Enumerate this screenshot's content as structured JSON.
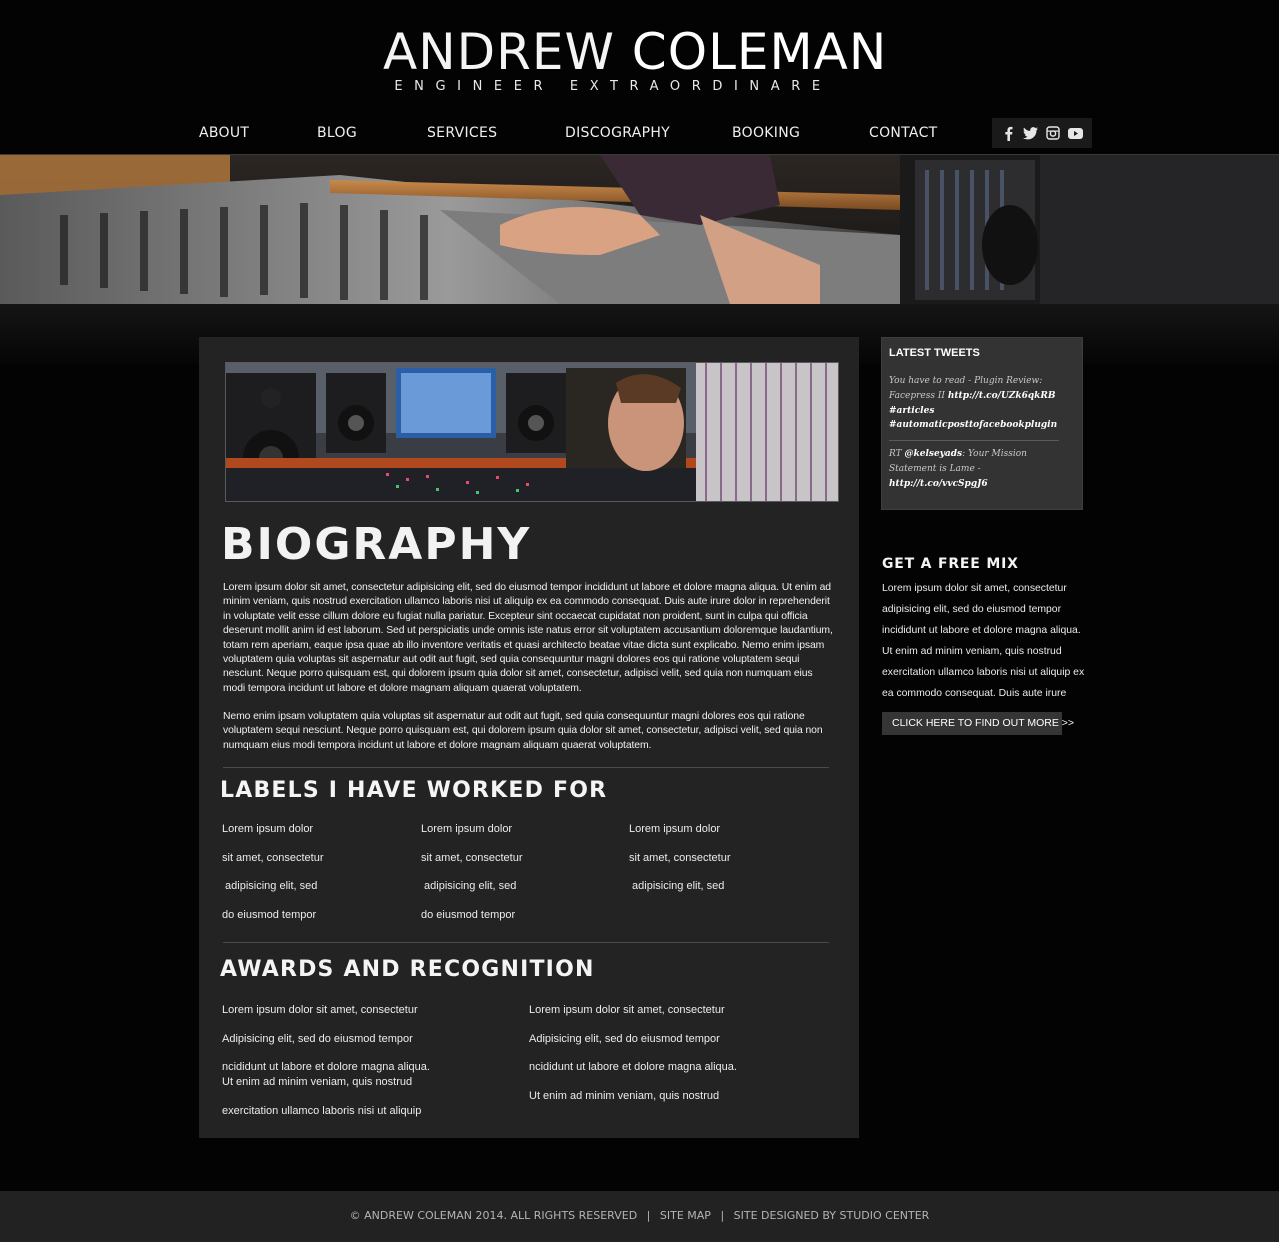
{
  "header": {
    "name_first": "ANDREW",
    "name_last": "COLEMAN",
    "tagline": "ENGINEER EXTRAORDINARE"
  },
  "nav": {
    "items": [
      "ABOUT",
      "BLOG",
      "SERVICES",
      "DISCOGRAPHY",
      "BOOKING",
      "CONTACT"
    ],
    "social_icons": [
      "facebook-icon",
      "twitter-icon",
      "instagram-icon",
      "youtube-icon"
    ]
  },
  "main": {
    "bio_title": "BIOGRAPHY",
    "bio_para1": "Lorem ipsum dolor sit amet, consectetur adipisicing elit, sed do eiusmod tempor incididunt ut labore et dolore magna aliqua. Ut enim ad minim veniam, quis nostrud exercitation ullamco laboris nisi ut aliquip ex ea commodo consequat. Duis aute irure dolor in reprehenderit in voluptate velit esse cillum dolore eu fugiat nulla pariatur. Excepteur sint occaecat cupidatat non proident, sunt in culpa qui officia deserunt mollit anim id est laborum. Sed ut perspiciatis unde omnis iste natus error sit voluptatem accusantium doloremque laudantium, totam rem aperiam, eaque ipsa quae ab illo inventore veritatis et quasi architecto beatae vitae dicta sunt explicabo. Nemo enim ipsam voluptatem quia voluptas sit aspernatur aut odit aut fugit, sed quia consequuntur magni dolores eos qui ratione voluptatem sequi nesciunt. Neque porro quisquam est, qui dolorem ipsum quia dolor sit amet, consectetur, adipisci velit, sed quia non numquam eius modi tempora incidunt ut labore et dolore magnam aliquam quaerat voluptatem.",
    "bio_para2": "Nemo enim ipsam voluptatem quia voluptas sit aspernatur aut odit aut fugit, sed quia consequuntur magni dolores eos qui ratione voluptatem sequi nesciunt. Neque porro quisquam est, qui dolorem ipsum quia dolor sit amet, consectetur, adipisci velit, sed quia non numquam eius modi tempora incidunt ut labore et dolore magnam aliquam quaerat voluptatem.",
    "labels_title": "LABELS I HAVE WORKED FOR",
    "labels_cols": [
      [
        "Lorem ipsum dolor",
        "sit amet, consectetur",
        " adipisicing elit, sed",
        "do eiusmod tempor"
      ],
      [
        "Lorem ipsum dolor",
        "sit amet, consectetur",
        " adipisicing elit, sed",
        "do eiusmod tempor"
      ],
      [
        "Lorem ipsum dolor",
        "sit amet, consectetur",
        " adipisicing elit, sed"
      ]
    ],
    "awards_title": "AWARDS AND RECOGNITION",
    "awards_left": [
      "Lorem ipsum dolor sit amet, consectetur",
      "Adipisicing elit, sed do eiusmod tempor",
      "ncididunt ut labore et dolore magna aliqua.",
      "Ut enim ad minim veniam, quis nostrud",
      "exercitation ullamco laboris nisi ut aliquip"
    ],
    "awards_right": [
      "Lorem ipsum dolor sit amet, consectetur",
      "Adipisicing elit, sed do eiusmod tempor",
      "ncididunt ut labore et dolore magna aliqua.",
      "Ut enim ad minim veniam, quis nostrud"
    ]
  },
  "sidebar": {
    "tweets_title": "LATEST TWEETS",
    "tweet1_text": "You have to read - Plugin Review: Facepress II",
    "tweet1_link": "http://t.co/UZk6qkRB",
    "tweet1_tag1": "#articles",
    "tweet1_tag2": "#automaticposttofacebookplugin",
    "tweet2_prefix": "RT",
    "tweet2_user": "@kelseyads",
    "tweet2_text": ": Your Mission Statement is Lame -",
    "tweet2_link": "http://t.co/vvcSpgJ6",
    "mix_title": "GET A FREE MIX",
    "mix_text": "Lorem ipsum dolor sit amet, consectetur adipisicing elit, sed do eiusmod tempor incididunt ut labore et dolore magna aliqua. Ut enim ad minim veniam, quis nostrud exercitation ullamco laboris nisi ut aliquip ex ea commodo consequat. Duis aute irure",
    "mix_button": "CLICK HERE TO FIND OUT MORE >>"
  },
  "footer": {
    "copyright": "© ANDREW COLEMAN 2014. ALL RIGHTS RESERVED",
    "sep": "|",
    "sitemap": "SITE MAP",
    "designed": "SITE DESIGNED BY STUDIO CENTER"
  }
}
